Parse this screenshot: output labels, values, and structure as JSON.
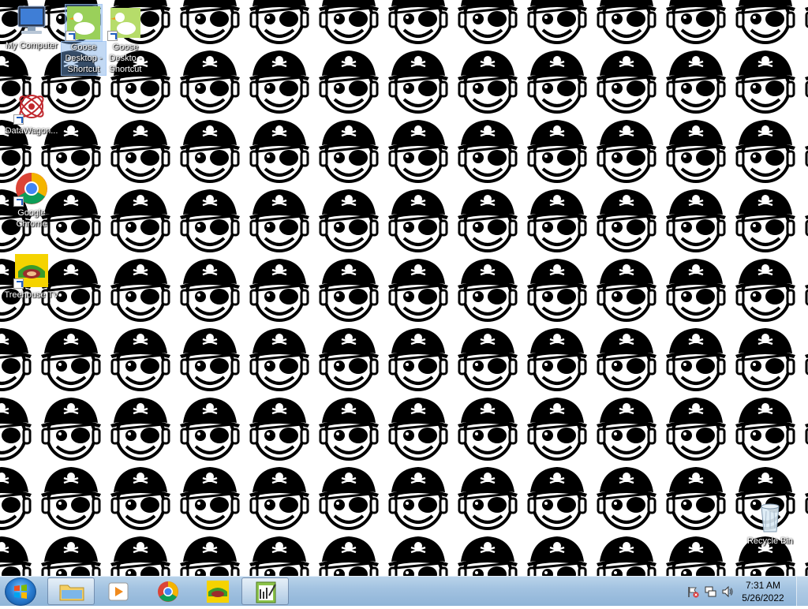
{
  "desktop": {
    "wallpaper": "pirate-smiley-pattern",
    "icons": [
      {
        "name": "my-computer-icon",
        "label": "My Computer"
      },
      {
        "name": "goose-desktop-shortcut-icon",
        "label": "Goose Desktop - Shortcut"
      },
      {
        "name": "goose-desktop-shortcut-2-icon",
        "label": "Goose Deskto - Shortcut"
      },
      {
        "name": "datawagon-icon",
        "label": "DataWagon..."
      },
      {
        "name": "google-chrome-icon",
        "label": "Google Chrome"
      },
      {
        "name": "treehouse-tv-icon",
        "label": "Treehouse TV"
      },
      {
        "name": "recycle-bin-icon",
        "label": "Recycle Bin"
      }
    ]
  },
  "taskbar": {
    "start": {
      "icon": "windows-logo-icon"
    },
    "pinned": [
      {
        "name": "explorer-taskbar-button",
        "icon": "folder-icon",
        "active": true
      },
      {
        "name": "media-player-taskbar-button",
        "icon": "media-player-icon",
        "active": false
      },
      {
        "name": "chrome-taskbar-button",
        "icon": "chrome-icon",
        "active": false
      },
      {
        "name": "treehouse-taskbar-button",
        "icon": "treehouse-icon",
        "active": false
      },
      {
        "name": "notepad-taskbar-button",
        "icon": "notepad-icon",
        "active": true
      }
    ],
    "tray": {
      "icons": [
        "action-center-flag-icon",
        "network-icon",
        "volume-icon"
      ],
      "time": "7:31 AM",
      "date": "5/26/2022"
    }
  }
}
